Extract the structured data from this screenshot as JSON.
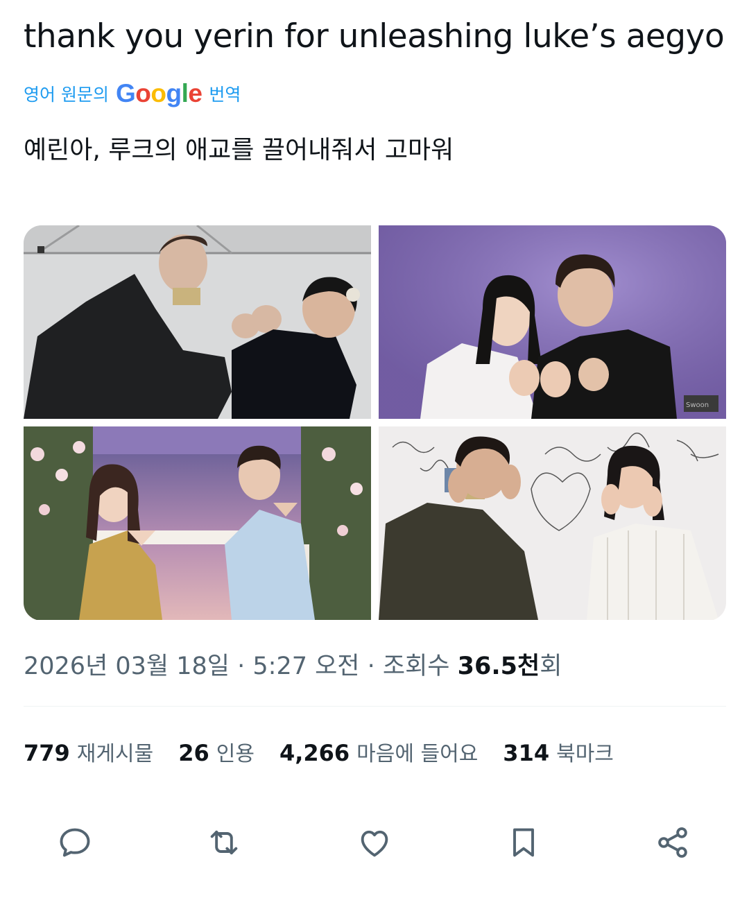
{
  "tweet": {
    "text": "thank you yerin for unleashing luke’s aegyo",
    "translate_prefix": "영어 원문의",
    "translate_suffix": "번역",
    "translated_text": "예린아, 루크의 애교를 끌어내줘서 고마워"
  },
  "google_logo": {
    "letters": [
      "G",
      "o",
      "o",
      "g",
      "l",
      "e"
    ]
  },
  "meta": {
    "date": "2026년 03월 18일",
    "sep1": " · ",
    "time": "5:27 오전",
    "sep2": " · ",
    "views_label": "조회수 ",
    "views_value": "36.5천",
    "views_suffix": "회"
  },
  "stats": [
    {
      "value": "779",
      "label": "재게시물"
    },
    {
      "value": "26",
      "label": "인용"
    },
    {
      "value": "4,266",
      "label": "마음에 들어요"
    },
    {
      "value": "314",
      "label": "북마크"
    }
  ],
  "media": {
    "watermark": "Swoon"
  },
  "actions": [
    "reply-icon",
    "retweet-icon",
    "like-icon",
    "bookmark-icon",
    "share-icon"
  ],
  "colors": {
    "link": "#1d9bf0",
    "secondary": "#536471",
    "primary": "#0f1419"
  }
}
